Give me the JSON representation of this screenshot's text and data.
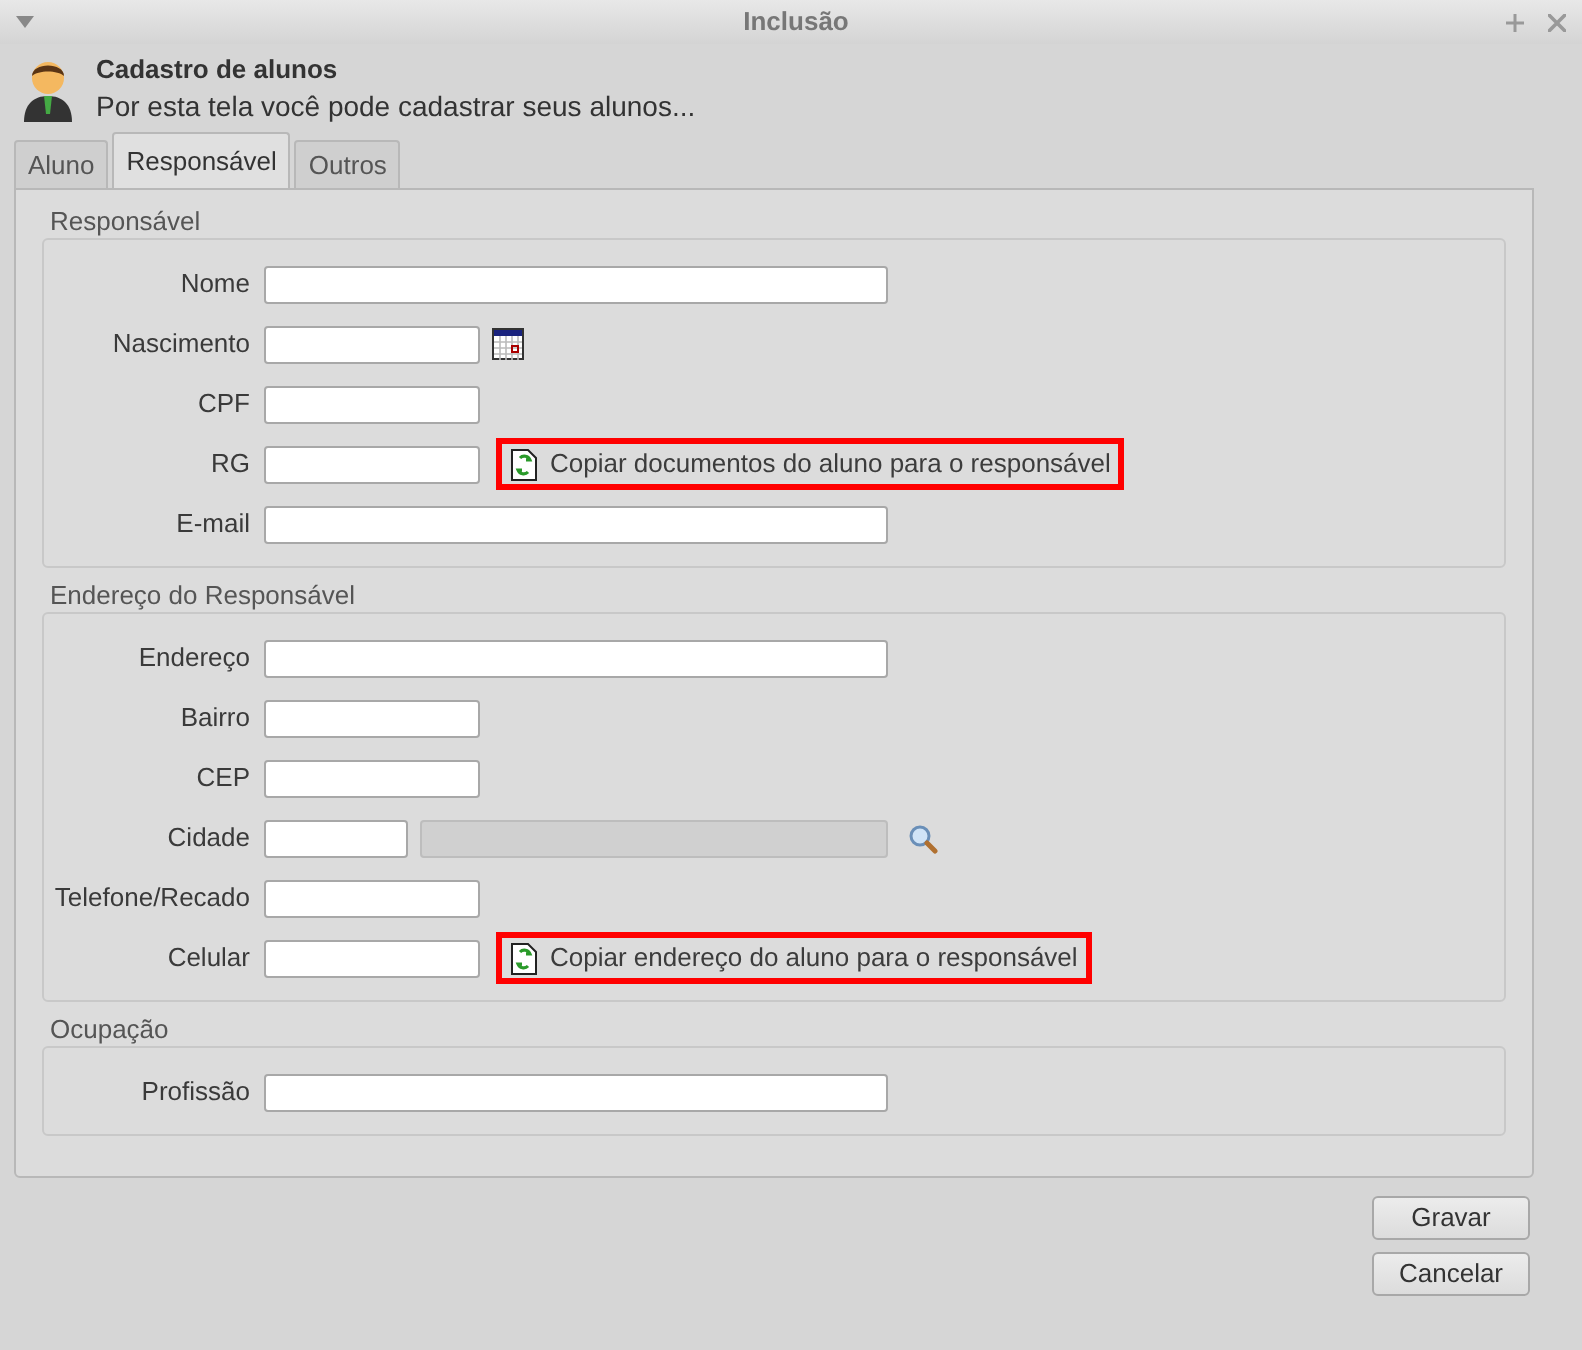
{
  "window": {
    "title": "Inclusão"
  },
  "header": {
    "title": "Cadastro de alunos",
    "subtitle": "Por esta tela você pode cadastrar seus alunos..."
  },
  "tabs": [
    {
      "label": "Aluno",
      "selected": false
    },
    {
      "label": "Responsável",
      "selected": true
    },
    {
      "label": "Outros",
      "selected": false
    }
  ],
  "groups": [
    {
      "title": "Responsável",
      "rows": [
        {
          "label": "Nome",
          "fields": [
            {
              "kind": "wide",
              "disabled": false
            }
          ]
        },
        {
          "label": "Nascimento",
          "fields": [
            {
              "kind": "short",
              "disabled": false
            }
          ],
          "extra": {
            "kind": "calendar"
          }
        },
        {
          "label": "CPF",
          "fields": [
            {
              "kind": "short",
              "disabled": false
            }
          ]
        },
        {
          "label": "RG",
          "fields": [
            {
              "kind": "short",
              "disabled": false
            }
          ],
          "extra": {
            "kind": "copy",
            "label": "Copiar documentos do aluno para o responsável",
            "highlighted": true
          }
        },
        {
          "label": "E-mail",
          "fields": [
            {
              "kind": "wide",
              "disabled": false
            }
          ]
        }
      ]
    },
    {
      "title": "Endereço do Responsável",
      "rows": [
        {
          "label": "Endereço",
          "fields": [
            {
              "kind": "wide",
              "disabled": false
            }
          ]
        },
        {
          "label": "Bairro",
          "fields": [
            {
              "kind": "short",
              "disabled": false
            }
          ]
        },
        {
          "label": "CEP",
          "fields": [
            {
              "kind": "short",
              "disabled": false
            }
          ]
        },
        {
          "label": "Cidade",
          "fields": [
            {
              "kind": "small",
              "disabled": false
            },
            {
              "kind": "medium",
              "disabled": true
            }
          ],
          "extra": {
            "kind": "search"
          }
        },
        {
          "label": "Telefone/Recado",
          "fields": [
            {
              "kind": "short",
              "disabled": false
            }
          ]
        },
        {
          "label": "Celular",
          "fields": [
            {
              "kind": "short",
              "disabled": false
            }
          ],
          "extra": {
            "kind": "copy",
            "label": "Copiar endereço do aluno para o responsável",
            "highlighted": true
          }
        }
      ]
    },
    {
      "title": "Ocupação",
      "rows": [
        {
          "label": "Profissão",
          "fields": [
            {
              "kind": "wide",
              "disabled": false
            }
          ]
        }
      ]
    }
  ],
  "buttons": [
    "Gravar",
    "Cancelar"
  ]
}
